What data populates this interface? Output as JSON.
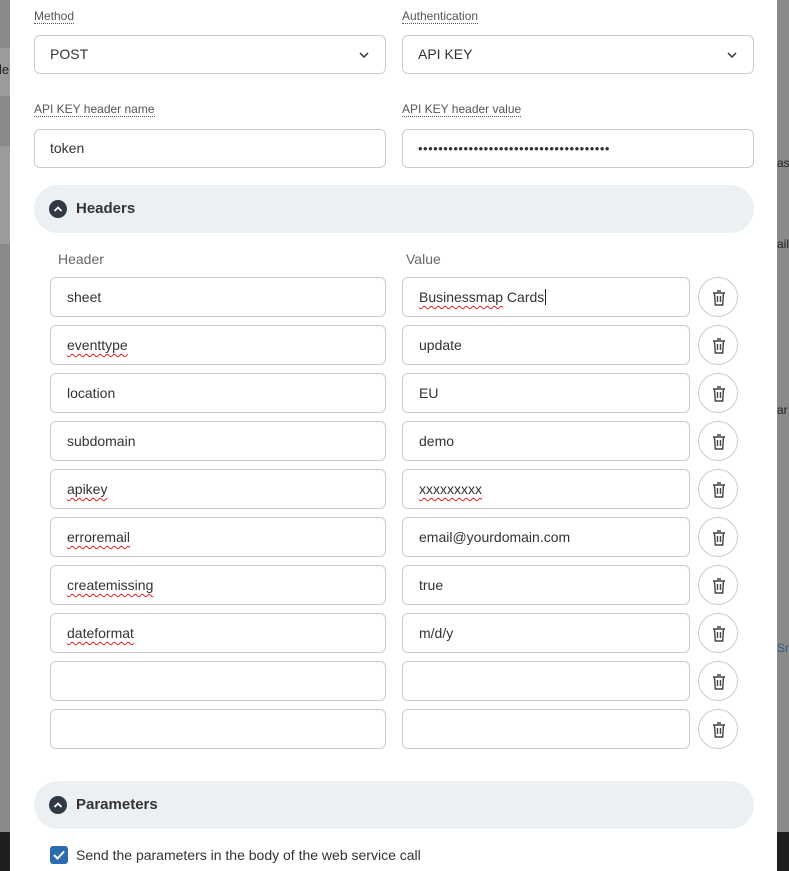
{
  "background": {
    "left_fragment": "le",
    "right_fragments": [
      "ask",
      "ails",
      "ar",
      "Sn"
    ]
  },
  "method": {
    "label": "Method",
    "value": "POST"
  },
  "authentication": {
    "label": "Authentication",
    "value": "API KEY"
  },
  "api_key_name": {
    "label": "API KEY header name",
    "value": "token"
  },
  "api_key_value": {
    "label": "API KEY header value",
    "value": "••••••••••••••••••••••••••••••••••••••"
  },
  "headers_section": {
    "title": "Headers",
    "col_header": "Header",
    "col_value": "Value",
    "rows": [
      {
        "key": "sheet",
        "value": "Businessmap Cards"
      },
      {
        "key": "eventtype",
        "value": "update"
      },
      {
        "key": "location",
        "value": "EU"
      },
      {
        "key": "subdomain",
        "value": "demo"
      },
      {
        "key": "apikey",
        "value": "xxxxxxxxx"
      },
      {
        "key": "erroremail",
        "value": "email@yourdomain.com"
      },
      {
        "key": "createmissing",
        "value": "true"
      },
      {
        "key": "dateformat",
        "value": "m/d/y"
      },
      {
        "key": "",
        "value": ""
      },
      {
        "key": "",
        "value": ""
      }
    ]
  },
  "parameters_section": {
    "title": "Parameters",
    "checkbox_label": "Send the parameters in the body of the web service call",
    "checkbox_checked": true
  },
  "colors": {
    "accent": "#2b6cb0",
    "section_bg": "#edf0f2",
    "border": "#c8cdd2"
  },
  "icons": {
    "dropdown": "chevron-down-icon",
    "collapse": "chevron-up-icon",
    "delete": "trash-icon",
    "check": "check-icon"
  }
}
